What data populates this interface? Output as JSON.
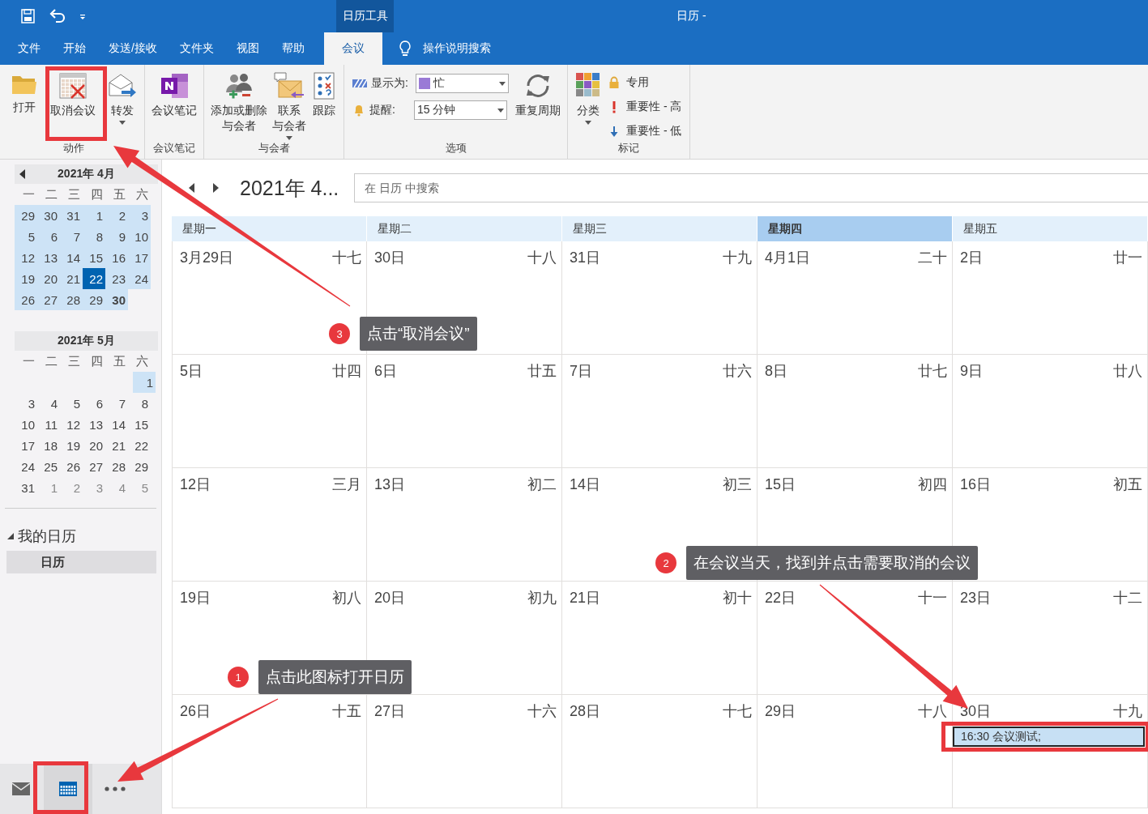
{
  "title_bar": {
    "context_tab": "日历工具",
    "title": "日历 -"
  },
  "menu_tabs": [
    {
      "label": "文件",
      "selected": false
    },
    {
      "label": "开始",
      "selected": false
    },
    {
      "label": "发送/接收",
      "selected": false
    },
    {
      "label": "文件夹",
      "selected": false
    },
    {
      "label": "视图",
      "selected": false
    },
    {
      "label": "帮助",
      "selected": false
    },
    {
      "label": "会议",
      "selected": true
    }
  ],
  "tell_me": "操作说明搜索",
  "ribbon": [
    {
      "label": "动作",
      "items": [
        {
          "kind": "open",
          "lines": [
            "打开"
          ],
          "dropdown": false
        },
        {
          "kind": "cancel",
          "lines": [
            "取消会议"
          ],
          "dropdown": false
        },
        {
          "kind": "forward",
          "lines": [
            "转发"
          ],
          "dropdown": true
        }
      ]
    },
    {
      "label": "会议笔记",
      "items": [
        {
          "kind": "notes",
          "lines": [
            "会议笔记"
          ],
          "dropdown": false
        }
      ]
    },
    {
      "label": "与会者",
      "items": [
        {
          "kind": "attendees",
          "lines": [
            "添加或删除",
            "与会者"
          ],
          "dropdown": false
        },
        {
          "kind": "contact",
          "lines": [
            "联系",
            "与会者"
          ],
          "dropdown": true
        },
        {
          "kind": "track",
          "lines": [
            "跟踪"
          ],
          "dropdown": false
        }
      ]
    },
    {
      "label": "选项",
      "items": [
        {
          "kind": "showas",
          "label": "显示为:",
          "value": "忙"
        },
        {
          "kind": "reminder",
          "label": "提醒:",
          "value": "15 分钟"
        },
        {
          "kind": "recurrence",
          "lines": [
            "重复周期"
          ],
          "dropdown": false
        }
      ]
    },
    {
      "label": "标记",
      "items": [
        {
          "kind": "categorize",
          "lines": [
            "分类"
          ],
          "dropdown": true
        },
        {
          "kind": "private",
          "label": "专用"
        },
        {
          "kind": "high",
          "label": "重要性 - 高"
        },
        {
          "kind": "low",
          "label": "重要性 - 低"
        }
      ]
    }
  ],
  "mini_calendars": [
    {
      "title": "2021年 4月",
      "nav": true,
      "weekdays": [
        "一",
        "二",
        "三",
        "四",
        "五",
        "六"
      ],
      "weeks": [
        [
          {
            "d": "29",
            "shaded": true,
            "today": false,
            "bold": false,
            "dim": false
          },
          {
            "d": "30",
            "shaded": true,
            "today": false,
            "bold": false,
            "dim": false
          },
          {
            "d": "31",
            "shaded": true,
            "today": false,
            "bold": false,
            "dim": false
          },
          {
            "d": "1",
            "shaded": true,
            "today": false,
            "bold": false,
            "dim": false
          },
          {
            "d": "2",
            "shaded": true,
            "today": false,
            "bold": false,
            "dim": false
          },
          {
            "d": "3",
            "shaded": true,
            "today": false,
            "bold": false,
            "dim": false
          }
        ],
        [
          {
            "d": "5",
            "shaded": true,
            "today": false,
            "bold": false,
            "dim": false
          },
          {
            "d": "6",
            "shaded": true,
            "today": false,
            "bold": false,
            "dim": false
          },
          {
            "d": "7",
            "shaded": true,
            "today": false,
            "bold": false,
            "dim": false
          },
          {
            "d": "8",
            "shaded": true,
            "today": false,
            "bold": false,
            "dim": false
          },
          {
            "d": "9",
            "shaded": true,
            "today": false,
            "bold": false,
            "dim": false
          },
          {
            "d": "10",
            "shaded": true,
            "today": false,
            "bold": false,
            "dim": false
          }
        ],
        [
          {
            "d": "12",
            "shaded": true,
            "today": false,
            "bold": false,
            "dim": false
          },
          {
            "d": "13",
            "shaded": true,
            "today": false,
            "bold": false,
            "dim": false
          },
          {
            "d": "14",
            "shaded": true,
            "today": false,
            "bold": false,
            "dim": false
          },
          {
            "d": "15",
            "shaded": true,
            "today": false,
            "bold": false,
            "dim": false
          },
          {
            "d": "16",
            "shaded": true,
            "today": false,
            "bold": false,
            "dim": false
          },
          {
            "d": "17",
            "shaded": true,
            "today": false,
            "bold": false,
            "dim": false
          }
        ],
        [
          {
            "d": "19",
            "shaded": true,
            "today": false,
            "bold": false,
            "dim": false
          },
          {
            "d": "20",
            "shaded": true,
            "today": false,
            "bold": false,
            "dim": false
          },
          {
            "d": "21",
            "shaded": true,
            "today": false,
            "bold": false,
            "dim": false
          },
          {
            "d": "22",
            "shaded": true,
            "today": true,
            "bold": false,
            "dim": false
          },
          {
            "d": "23",
            "shaded": true,
            "today": false,
            "bold": false,
            "dim": false
          },
          {
            "d": "24",
            "shaded": true,
            "today": false,
            "bold": false,
            "dim": false
          }
        ],
        [
          {
            "d": "26",
            "shaded": true,
            "today": false,
            "bold": false,
            "dim": false
          },
          {
            "d": "27",
            "shaded": true,
            "today": false,
            "bold": false,
            "dim": false
          },
          {
            "d": "28",
            "shaded": true,
            "today": false,
            "bold": false,
            "dim": false
          },
          {
            "d": "29",
            "shaded": true,
            "today": false,
            "bold": false,
            "dim": false
          },
          {
            "d": "30",
            "shaded": true,
            "today": false,
            "bold": true,
            "dim": false
          }
        ]
      ]
    },
    {
      "title": "2021年 5月",
      "nav": false,
      "weekdays": [
        "一",
        "二",
        "三",
        "四",
        "五",
        "六"
      ],
      "weeks": [
        [
          {
            "d": "1",
            "shaded": true,
            "today": false,
            "bold": false,
            "dim": false
          }
        ],
        [
          {
            "d": "3",
            "shaded": false,
            "today": false,
            "bold": false,
            "dim": false
          },
          {
            "d": "4",
            "shaded": false,
            "today": false,
            "bold": false,
            "dim": false
          },
          {
            "d": "5",
            "shaded": false,
            "today": false,
            "bold": false,
            "dim": false
          },
          {
            "d": "6",
            "shaded": false,
            "today": false,
            "bold": false,
            "dim": false
          },
          {
            "d": "7",
            "shaded": false,
            "today": false,
            "bold": false,
            "dim": false
          },
          {
            "d": "8",
            "shaded": false,
            "today": false,
            "bold": false,
            "dim": false
          }
        ],
        [
          {
            "d": "10",
            "shaded": false,
            "today": false,
            "bold": false,
            "dim": false
          },
          {
            "d": "11",
            "shaded": false,
            "today": false,
            "bold": false,
            "dim": false
          },
          {
            "d": "12",
            "shaded": false,
            "today": false,
            "bold": false,
            "dim": false
          },
          {
            "d": "13",
            "shaded": false,
            "today": false,
            "bold": false,
            "dim": false
          },
          {
            "d": "14",
            "shaded": false,
            "today": false,
            "bold": false,
            "dim": false
          },
          {
            "d": "15",
            "shaded": false,
            "today": false,
            "bold": false,
            "dim": false
          }
        ],
        [
          {
            "d": "17",
            "shaded": false,
            "today": false,
            "bold": false,
            "dim": false
          },
          {
            "d": "18",
            "shaded": false,
            "today": false,
            "bold": false,
            "dim": false
          },
          {
            "d": "19",
            "shaded": false,
            "today": false,
            "bold": false,
            "dim": false
          },
          {
            "d": "20",
            "shaded": false,
            "today": false,
            "bold": false,
            "dim": false
          },
          {
            "d": "21",
            "shaded": false,
            "today": false,
            "bold": false,
            "dim": false
          },
          {
            "d": "22",
            "shaded": false,
            "today": false,
            "bold": false,
            "dim": false
          }
        ],
        [
          {
            "d": "24",
            "shaded": false,
            "today": false,
            "bold": false,
            "dim": false
          },
          {
            "d": "25",
            "shaded": false,
            "today": false,
            "bold": false,
            "dim": false
          },
          {
            "d": "26",
            "shaded": false,
            "today": false,
            "bold": false,
            "dim": false
          },
          {
            "d": "27",
            "shaded": false,
            "today": false,
            "bold": false,
            "dim": false
          },
          {
            "d": "28",
            "shaded": false,
            "today": false,
            "bold": false,
            "dim": false
          },
          {
            "d": "29",
            "shaded": false,
            "today": false,
            "bold": false,
            "dim": false
          }
        ],
        [
          {
            "d": "31",
            "shaded": false,
            "today": false,
            "bold": false,
            "dim": false
          },
          {
            "d": "1",
            "shaded": false,
            "today": false,
            "bold": false,
            "dim": true
          },
          {
            "d": "2",
            "shaded": false,
            "today": false,
            "bold": false,
            "dim": true
          },
          {
            "d": "3",
            "shaded": false,
            "today": false,
            "bold": false,
            "dim": true
          },
          {
            "d": "4",
            "shaded": false,
            "today": false,
            "bold": false,
            "dim": true
          },
          {
            "d": "5",
            "shaded": false,
            "today": false,
            "bold": false,
            "dim": true
          }
        ]
      ]
    }
  ],
  "folders": {
    "label": "我的日历",
    "expanded": true,
    "items": [
      {
        "label": "日历",
        "selected": true
      }
    ]
  },
  "bottom_nav": [
    {
      "kind": "mail",
      "selected": false
    },
    {
      "kind": "calendar",
      "selected": true
    },
    {
      "kind": "more",
      "selected": false
    }
  ],
  "calendar": {
    "title": "2021年 4...",
    "search": {
      "placeholder": "在 日历 中搜索"
    },
    "days": [
      {
        "label": "星期一",
        "selected": false
      },
      {
        "label": "星期二",
        "selected": false
      },
      {
        "label": "星期三",
        "selected": false
      },
      {
        "label": "星期四",
        "selected": true
      },
      {
        "label": "星期五",
        "selected": false
      }
    ],
    "weeks": [
      [
        {
          "date": "3月29日",
          "lunar": "十七"
        },
        {
          "date": "30日",
          "lunar": "十八"
        },
        {
          "date": "31日",
          "lunar": "十九"
        },
        {
          "date": "4月1日",
          "lunar": "二十"
        },
        {
          "date": "2日",
          "lunar": "廿一"
        }
      ],
      [
        {
          "date": "5日",
          "lunar": "廿四"
        },
        {
          "date": "6日",
          "lunar": "廿五"
        },
        {
          "date": "7日",
          "lunar": "廿六"
        },
        {
          "date": "8日",
          "lunar": "廿七"
        },
        {
          "date": "9日",
          "lunar": "廿八"
        }
      ],
      [
        {
          "date": "12日",
          "lunar": "三月"
        },
        {
          "date": "13日",
          "lunar": "初二"
        },
        {
          "date": "14日",
          "lunar": "初三"
        },
        {
          "date": "15日",
          "lunar": "初四"
        },
        {
          "date": "16日",
          "lunar": "初五"
        }
      ],
      [
        {
          "date": "19日",
          "lunar": "初八"
        },
        {
          "date": "20日",
          "lunar": "初九"
        },
        {
          "date": "21日",
          "lunar": "初十"
        },
        {
          "date": "22日",
          "lunar": "十一"
        },
        {
          "date": "23日",
          "lunar": "十二"
        }
      ],
      [
        {
          "date": "26日",
          "lunar": "十五"
        },
        {
          "date": "27日",
          "lunar": "十六"
        },
        {
          "date": "28日",
          "lunar": "十七"
        },
        {
          "date": "29日",
          "lunar": "十八"
        },
        {
          "date": "30日",
          "lunar": "十九",
          "events": [
            "16:30 会议测试;"
          ]
        }
      ]
    ]
  },
  "annotations": [
    {
      "number": "3",
      "text": "点击“取消会议”"
    },
    {
      "number": "2",
      "text": "在会议当天，找到并点击需要取消的会议"
    },
    {
      "number": "1",
      "text": "点击此图标打开日历"
    }
  ]
}
